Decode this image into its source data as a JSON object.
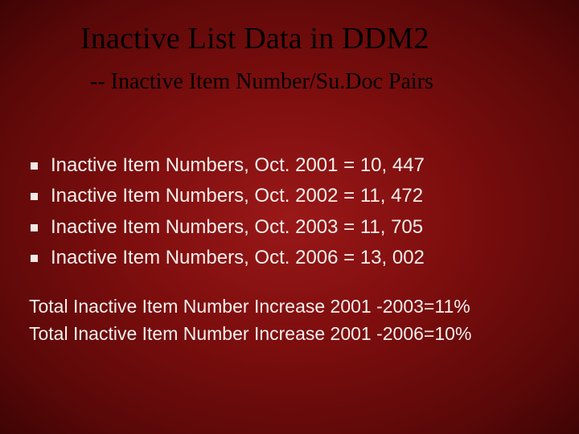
{
  "title": "Inactive List Data in DDM2",
  "subtitle": "-- Inactive Item Number/Su.Doc Pairs",
  "bullets": [
    "Inactive Item Numbers, Oct. 2001 = 10, 447",
    "Inactive Item Numbers, Oct. 2002 = 11, 472",
    "Inactive Item Numbers, Oct. 2003 = 11, 705",
    "Inactive Item Numbers, Oct. 2006 = 13, 002"
  ],
  "footer": [
    "Total Inactive Item Number Increase 2001 -2003=11%",
    "Total Inactive Item Number Increase 2001 -2006=10%"
  ],
  "chart_data": {
    "type": "table",
    "title": "Inactive Item Numbers by Year",
    "categories": [
      "Oct. 2001",
      "Oct. 2002",
      "Oct. 2003",
      "Oct. 2006"
    ],
    "values": [
      10447,
      11472,
      11705,
      13002
    ],
    "annotations": [
      {
        "label": "Increase 2001-2003",
        "value_pct": 11
      },
      {
        "label": "Increase 2001-2006",
        "value_pct": 10
      }
    ]
  }
}
